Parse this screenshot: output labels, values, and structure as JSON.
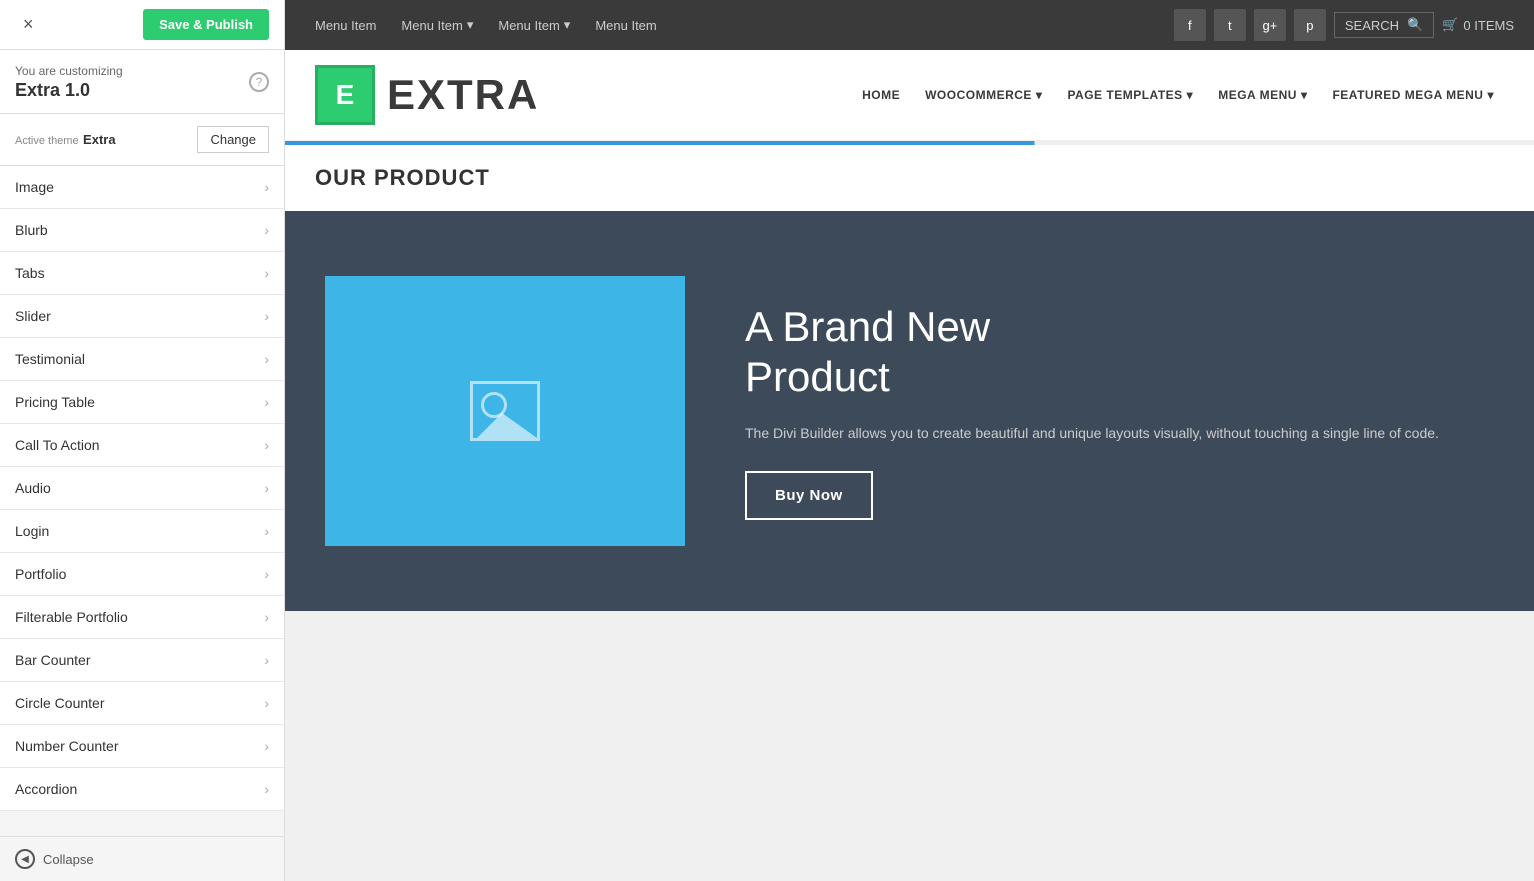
{
  "sidebar": {
    "close_icon": "×",
    "save_publish_label": "Save & Publish",
    "customizing_label": "You are customizing",
    "theme_name": "Extra 1.0",
    "active_theme_label": "Active theme",
    "active_theme_value": "Extra",
    "change_button": "Change",
    "help_icon": "?",
    "menu_items": [
      {
        "label": "Image"
      },
      {
        "label": "Blurb"
      },
      {
        "label": "Tabs"
      },
      {
        "label": "Slider"
      },
      {
        "label": "Testimonial"
      },
      {
        "label": "Pricing Table"
      },
      {
        "label": "Call To Action"
      },
      {
        "label": "Audio"
      },
      {
        "label": "Login"
      },
      {
        "label": "Portfolio"
      },
      {
        "label": "Filterable Portfolio"
      },
      {
        "label": "Bar Counter"
      },
      {
        "label": "Circle Counter"
      },
      {
        "label": "Number Counter"
      },
      {
        "label": "Accordion"
      }
    ],
    "collapse_label": "Collapse"
  },
  "top_nav": {
    "items": [
      {
        "label": "Menu Item"
      },
      {
        "label": "Menu Item",
        "has_dropdown": true
      },
      {
        "label": "Menu Item",
        "has_dropdown": true
      },
      {
        "label": "Menu Item"
      }
    ],
    "social": [
      "f",
      "t",
      "g+",
      "p"
    ],
    "search_placeholder": "SEARCH",
    "cart_label": "0 ITEMS"
  },
  "brand_nav": {
    "logo_letter": "E",
    "brand_name": "EXTRA",
    "nav_items": [
      {
        "label": "HOME"
      },
      {
        "label": "WOOCOMMERCE",
        "has_dropdown": true
      },
      {
        "label": "PAGE TEMPLATES",
        "has_dropdown": true
      },
      {
        "label": "MEGA MENU",
        "has_dropdown": true
      },
      {
        "label": "FEATURED MEGA MENU",
        "has_dropdown": true
      }
    ]
  },
  "product_section": {
    "header": "OUR PRODUCT",
    "title_line1": "A Brand New",
    "title_line2": "Product",
    "description": "The Divi Builder allows you to create beautiful and unique layouts visually, without touching a single line of code.",
    "buy_button": "Buy Now"
  },
  "colors": {
    "accent_green": "#2ecc71",
    "accent_blue": "#3498db",
    "dark_bg": "#3d4a5a",
    "image_blue": "#3db5e6"
  }
}
